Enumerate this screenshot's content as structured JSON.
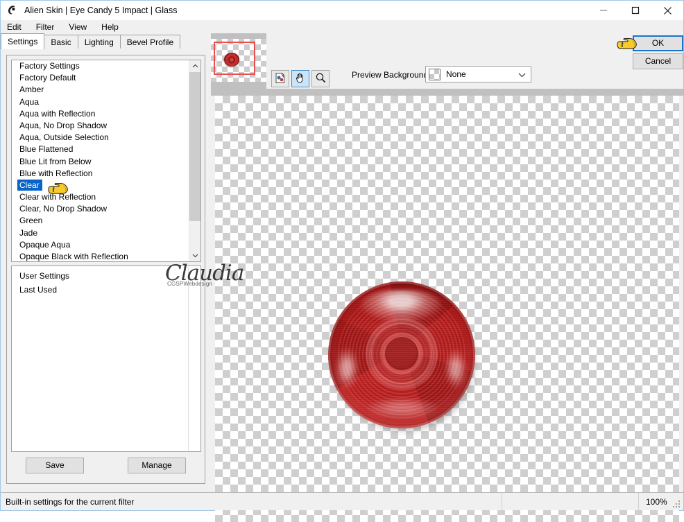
{
  "window": {
    "title": "Alien Skin | Eye Candy 5 Impact | Glass",
    "app_icon": "alien-skin-icon",
    "controls": {
      "minimize": "–",
      "maximize": "□",
      "close": "✕"
    }
  },
  "menubar": {
    "items": [
      {
        "label": "Edit"
      },
      {
        "label": "Filter"
      },
      {
        "label": "View"
      },
      {
        "label": "Help"
      }
    ]
  },
  "tabs": [
    {
      "label": "Settings",
      "active": true
    },
    {
      "label": "Basic",
      "active": false
    },
    {
      "label": "Lighting",
      "active": false
    },
    {
      "label": "Bevel Profile",
      "active": false
    }
  ],
  "settings_panel": {
    "factory_list": {
      "header": "Factory Settings",
      "items": [
        "Factory Default",
        "Amber",
        "Aqua",
        "Aqua with Reflection",
        "Aqua, No Drop Shadow",
        "Aqua, Outside Selection",
        "Blue Flattened",
        "Blue Lit from Below",
        "Blue with Reflection",
        "Clear",
        "Clear with Reflection",
        "Clear, No Drop Shadow",
        "Green",
        "Jade",
        "Opaque Aqua",
        "Opaque Black with Reflection"
      ],
      "selected": "Clear"
    },
    "user_list": {
      "header": "User Settings",
      "items": [
        "Last Used"
      ]
    },
    "buttons": {
      "save": "Save",
      "manage": "Manage"
    }
  },
  "watermark": {
    "script": "Claudia",
    "subtitle": "CGSPWebdesign"
  },
  "preview_toolbar": {
    "tools": [
      {
        "name": "before-after-icon",
        "selected": false
      },
      {
        "name": "hand-pan-icon",
        "selected": true
      },
      {
        "name": "magnifier-zoom-icon",
        "selected": false
      }
    ],
    "preview_background_label": "Preview Background:",
    "preview_background_value": "None",
    "preview_background_options": [
      "None"
    ]
  },
  "dialog_buttons": {
    "ok": "OK",
    "cancel": "Cancel"
  },
  "statusbar": {
    "message": "Built-in settings for the current filter",
    "zoom": "100%"
  },
  "colors": {
    "accent_selection": "#0a64c8",
    "focus_border": "#1b74c9",
    "nav_rect": "#e85050",
    "orb_red": "#a81c1c",
    "window_chrome": "#f0f0f0"
  },
  "preview": {
    "subject": "red-glass-orb",
    "background": "transparent-checkerboard"
  }
}
